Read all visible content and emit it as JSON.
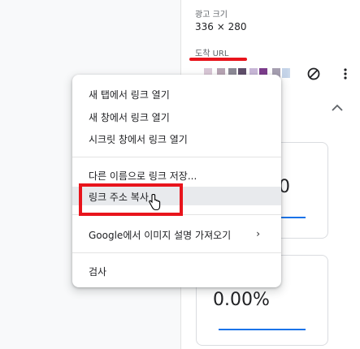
{
  "side_panel": {
    "ad_size_label": "광고 크기",
    "ad_size_value": "336 × 280",
    "dest_url_label": "도착 URL",
    "block_icon": "block-icon",
    "more_icon": "more-vert-icon",
    "collapse_icon": "chevron-up-icon"
  },
  "cards": [
    {
      "value": "0"
    },
    {
      "value": "0.00%"
    }
  ],
  "context_menu": {
    "items": [
      {
        "label": "새 탭에서 링크 열기"
      },
      {
        "label": "새 창에서 링크 열기"
      },
      {
        "label": "시크릿 창에서 링크 열기"
      },
      {
        "label": "다른 이름으로 링크 저장..."
      },
      {
        "label": "링크 주소 복사"
      },
      {
        "label": "Google에서 이미지 설명 가져오기"
      },
      {
        "label": "검사"
      }
    ],
    "submenu_arrow": "›"
  },
  "colors": {
    "highlight_red": "#e8141c",
    "accent_blue": "#1a73e8",
    "hover_gray": "#e8eaed"
  }
}
